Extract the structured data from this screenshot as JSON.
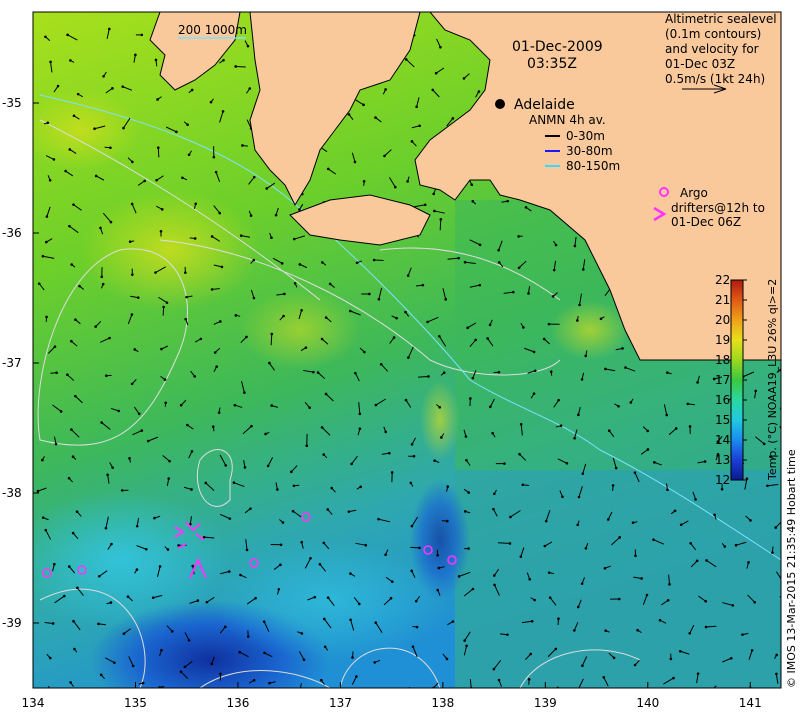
{
  "date_line": "01-Dec-2009",
  "time_line": "03:35Z",
  "scale_label": "200  1000m",
  "sealevel_legend": [
    "Altimetric sealevel",
    "(0.1m contours)",
    "and velocity for",
    "01-Dec 03Z",
    "0.5m/s (1kt 24h)"
  ],
  "city_label": "Adelaide",
  "anmn": {
    "title": "ANMN 4h av.",
    "items": [
      {
        "label": "0-30m",
        "color": "#000000"
      },
      {
        "label": "30-80m",
        "color": "#1a1aff"
      },
      {
        "label": "80-150m",
        "color": "#33ddff"
      }
    ]
  },
  "argo": {
    "label": "Argo",
    "drifter_lines": [
      "drifters@12h to",
      "01-Dec 06Z"
    ],
    "color": "#ff33ff"
  },
  "colorbar": {
    "title": "Temp. (°C) NOAA19_L3U 26% ql>=2",
    "ticks": [
      "22",
      "21",
      "20",
      "19",
      "18",
      "17",
      "16",
      "15",
      "14",
      "13",
      "12"
    ],
    "min": 12,
    "max": 22
  },
  "credit": "© IMOS 13-Mar-2015 21:35:49 Hobart time",
  "axes": {
    "x_ticks": [
      "134",
      "135",
      "136",
      "137",
      "138",
      "139",
      "140",
      "141"
    ],
    "y_ticks": [
      "-35",
      "-36",
      "-37",
      "-38",
      "-39"
    ],
    "lon_range": [
      134,
      141.3
    ],
    "lat_range": [
      -39.5,
      -34.3
    ]
  },
  "colors": {
    "land": "#f9c99c",
    "contour": "#dddddd",
    "shelf_line": "#7fe0ff"
  }
}
